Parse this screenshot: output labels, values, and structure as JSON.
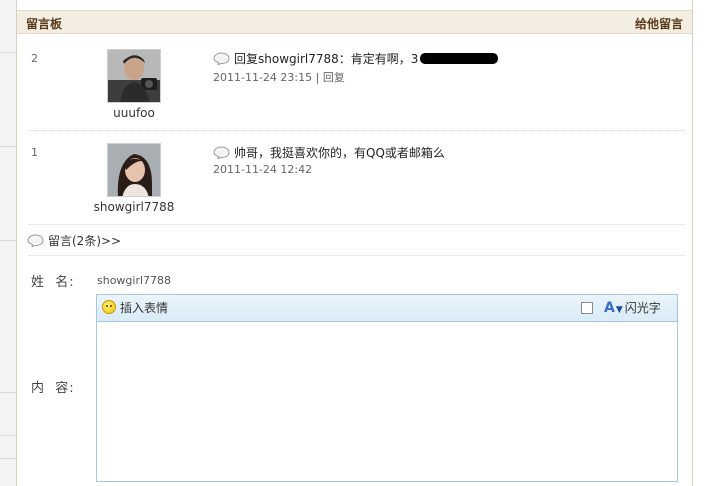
{
  "header": {
    "title": "留言板",
    "action": "给他留言"
  },
  "entries": [
    {
      "number": "2",
      "username": "uuufoo",
      "message_prefix": "回复showgirl7788：肯定有啊，3",
      "time": "2011-11-24 23:15",
      "separator": "|",
      "reply_label": "回复",
      "avatar_desc": "avatar-photo-man"
    },
    {
      "number": "1",
      "username": "showgirl7788",
      "message_prefix": "帅哥，我挺喜欢你的，有QQ或者邮箱么",
      "time": "2011-11-24 12:42",
      "avatar_desc": "avatar-photo-woman"
    }
  ],
  "more_link": "留言(2条)>>",
  "form": {
    "name_label": "姓  名:",
    "name_value": "showgirl7788",
    "content_label": "内  容:",
    "toolbar": {
      "emoticon_label": "插入表情",
      "flash_label": "闪光字"
    }
  },
  "colors": {
    "header_bg": "#f3ede2",
    "header_text": "#5a3a1c",
    "editor_border": "#a9c7dc"
  }
}
